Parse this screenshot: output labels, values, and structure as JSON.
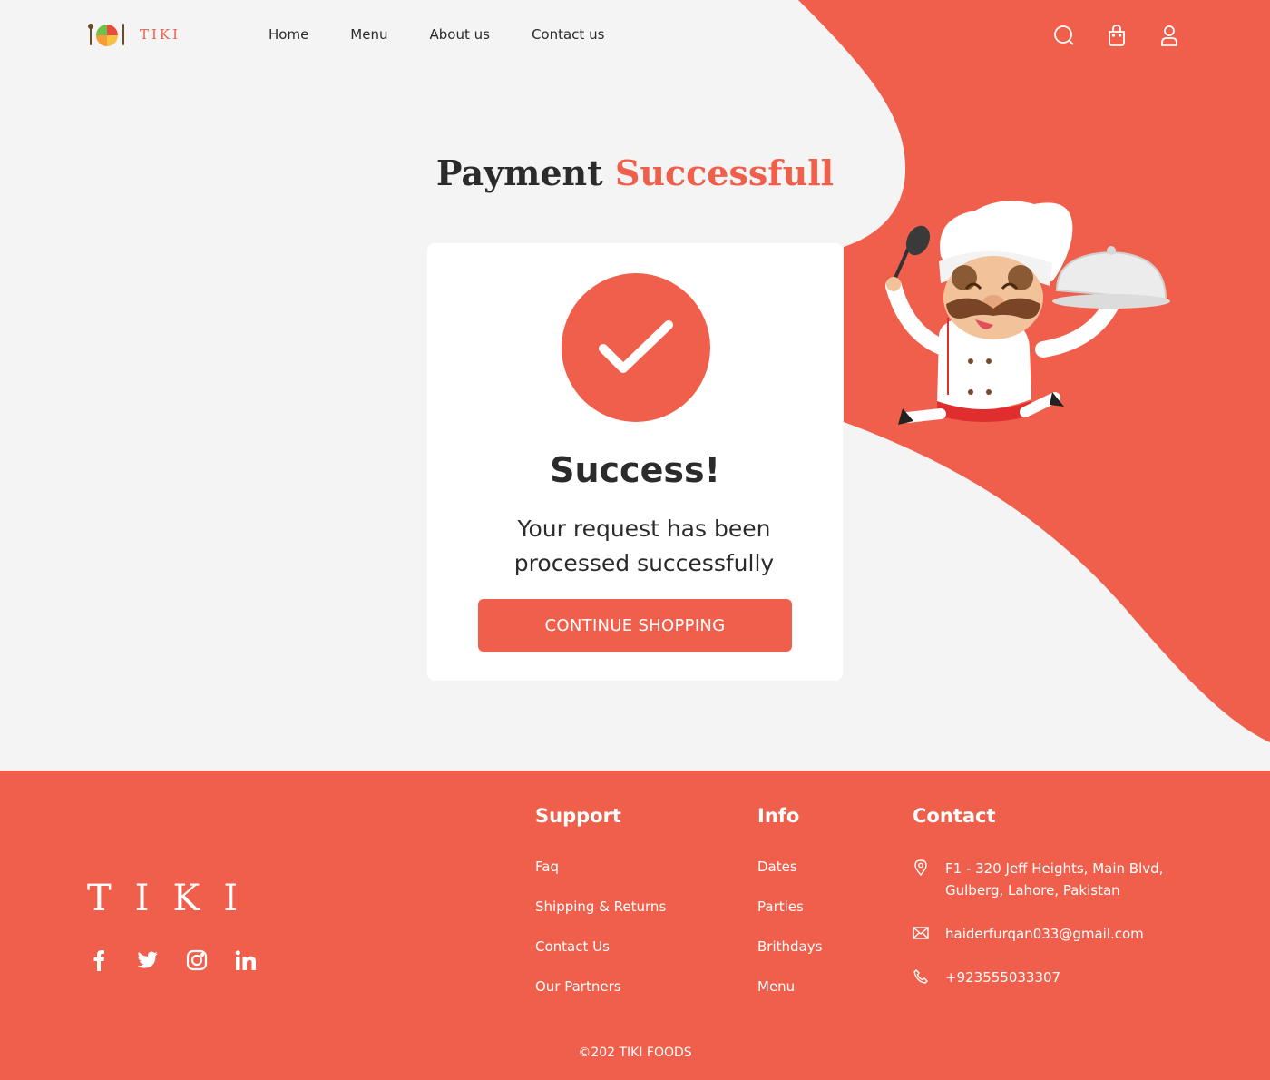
{
  "brand": {
    "name": "TIKI",
    "accent_color": "#f05f4b"
  },
  "nav": {
    "links": [
      "Home",
      "Menu",
      "About us",
      "Contact us"
    ],
    "icons": [
      "search-icon",
      "shopping-bag-icon",
      "user-icon"
    ]
  },
  "page": {
    "title_main": "Payment",
    "title_accent": "Successfull"
  },
  "card": {
    "heading": "Success!",
    "message": "Your request has been processed successfully",
    "button_label": "CONTINUE SHOPPING"
  },
  "footer": {
    "logo": "TIKI",
    "socials": [
      "facebook-icon",
      "twitter-icon",
      "instagram-icon",
      "linkedin-icon"
    ],
    "support": {
      "heading": "Support",
      "links": [
        "Faq",
        "Shipping & Returns",
        "Contact Us",
        "Our Partners"
      ]
    },
    "info": {
      "heading": "Info",
      "links": [
        "Dates",
        "Parties",
        "Brithdays",
        "Menu"
      ]
    },
    "contact": {
      "heading": "Contact",
      "address": "F1 - 320 Jeff Heights, Main Blvd, Gulberg, Lahore, Pakistan",
      "email": "haiderfurqan033@gmail.com",
      "phone": "+923555033307"
    },
    "copyright": "©202 TIKI FOODS"
  }
}
